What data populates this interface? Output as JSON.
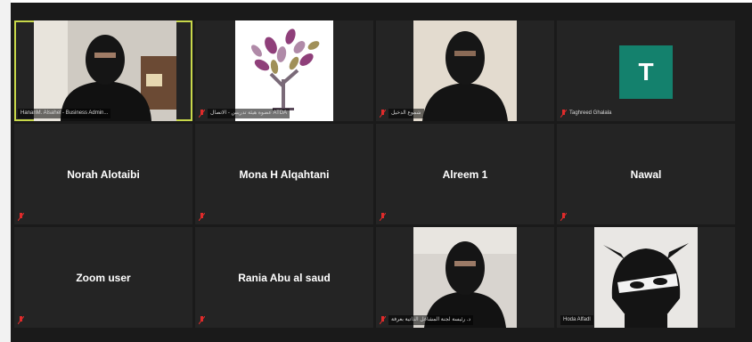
{
  "participants": [
    {
      "name": "HananM. Alsahel - Business Admin...",
      "type": "video-person",
      "active": true
    },
    {
      "name": "عضوة هيئة تدريس - الاتصال ATDA",
      "type": "logo"
    },
    {
      "name": "شموع الدخيل",
      "type": "video-person"
    },
    {
      "name": "Taghreed Ghalala",
      "type": "initial",
      "initial": "T"
    },
    {
      "name": "Norah Alotaibi",
      "type": "name"
    },
    {
      "name": "Mona H Alqahtani",
      "type": "name"
    },
    {
      "name": "Alreem 1",
      "type": "name"
    },
    {
      "name": "Nawal",
      "type": "name"
    },
    {
      "name": "Zoom user",
      "type": "name"
    },
    {
      "name": "Rania Abu al saud",
      "type": "name"
    },
    {
      "name": "د. رئيسة لجنة المشاغل الذاتية بعرفة",
      "type": "video-person"
    },
    {
      "name": "Hoda Alfadl",
      "type": "ninja"
    }
  ],
  "colors": {
    "active_border": "#c8d84a",
    "muted_icon": "#e02b2b",
    "initial_bg": "#14816d"
  }
}
